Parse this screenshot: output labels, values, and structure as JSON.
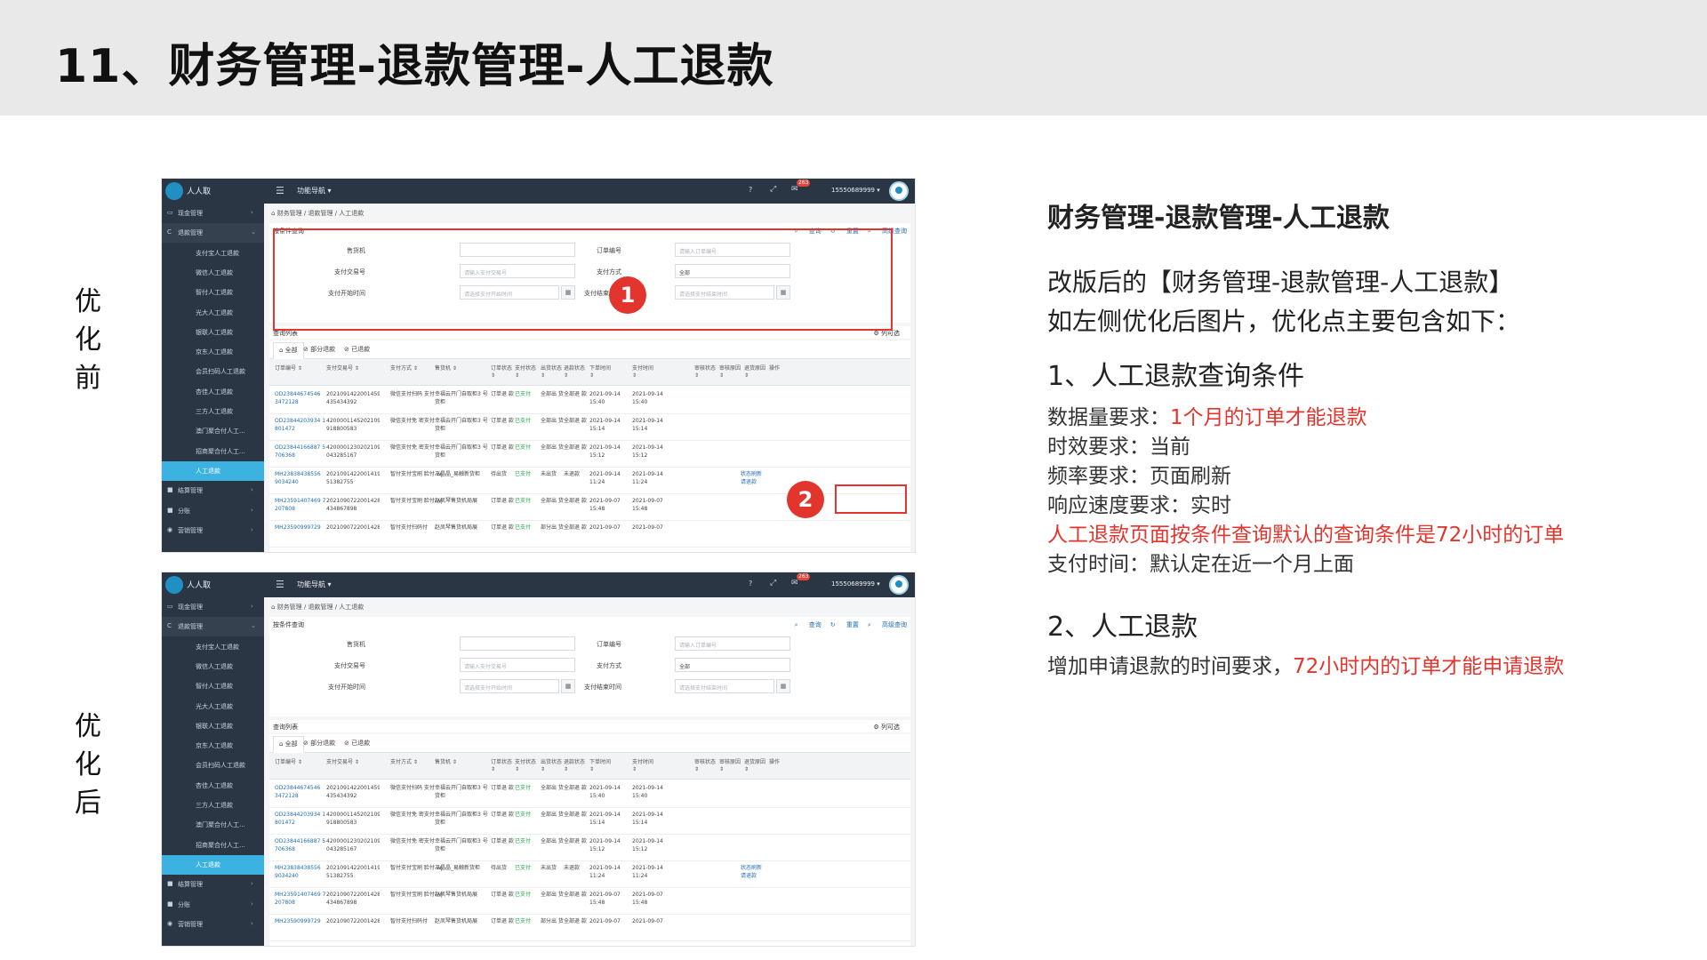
{
  "slide": {
    "title": "11、财务管理-退款管理-人工退款",
    "label_before": "优化前",
    "label_after": "优化后"
  },
  "screenshot": {
    "app_name": "人人取",
    "func_nav": "功能导航 ▾",
    "help": "?",
    "notif_count": "263",
    "user": "15550689999 ▾",
    "breadcrumb": "财务管理 / 退款管理 / 人工退款",
    "sidebar": [
      {
        "label": "现金管理",
        "level": 1,
        "icon": "▭",
        "arrow": "›"
      },
      {
        "label": "退款管理",
        "level": 1,
        "icon": "C",
        "arrow": "⌄",
        "open": true
      },
      {
        "label": "支付宝人工退款",
        "level": 2
      },
      {
        "label": "微信人工退款",
        "level": 2
      },
      {
        "label": "智付人工退款",
        "level": 2
      },
      {
        "label": "光大人工退款",
        "level": 2
      },
      {
        "label": "银联人工退款",
        "level": 2
      },
      {
        "label": "京东人工退款",
        "level": 2
      },
      {
        "label": "会员扫码人工退款",
        "level": 2
      },
      {
        "label": "杏佳人工退款",
        "level": 2
      },
      {
        "label": "三方人工退款",
        "level": 2
      },
      {
        "label": "澳门聚合付人工...",
        "level": 2
      },
      {
        "label": "招商聚合付人工...",
        "level": 2
      },
      {
        "label": "人工退款",
        "level": 2,
        "active": true
      },
      {
        "label": "结算管理",
        "level": 1,
        "icon": "■",
        "arrow": "›"
      },
      {
        "label": "分账",
        "level": 1,
        "icon": "■",
        "arrow": "›"
      },
      {
        "label": "营销管理",
        "level": 1,
        "icon": "◉",
        "arrow": "›"
      }
    ],
    "search_panel": {
      "title": "按条件查询",
      "actions": [
        "查询",
        "重置",
        "高级查询"
      ],
      "fields": {
        "sale_machine": {
          "label": "售货机",
          "placeholder": ""
        },
        "order_no": {
          "label": "订单编号",
          "placeholder": "请输入订单编号"
        },
        "pay_trade_no": {
          "label": "支付交易号",
          "placeholder": "请输入支付交易号"
        },
        "pay_method": {
          "label": "支付方式",
          "value": "全部"
        },
        "pay_start": {
          "label": "支付开始时间",
          "placeholder": "请选择支付开始时间"
        },
        "pay_end": {
          "label": "支付结束时间",
          "placeholder": "请选择支付结束时间"
        }
      }
    },
    "list": {
      "title": "查询列表",
      "column_selector": "列可选",
      "tabs": [
        "全部",
        "部分退款",
        "已退款"
      ],
      "headers": [
        "订单编号 ⇕",
        "支付交易号 ⇕",
        "支付方式 ⇕",
        "售货机 ⇕",
        "订单状态 ⇕",
        "支付状态 ⇕",
        "出货状态 ⇕",
        "退款状态 ⇕",
        "下单时间 ⇕",
        "支付时间 ⇕",
        "审核状态 ⇕",
        "审核原因 ⇕",
        "退货原因 ⇕",
        "操作"
      ],
      "rows": [
        [
          "OD23844674546 3472128",
          "2021091422001459461 435434392",
          "微信支付扫码 支付",
          "幸福云开门自取柜3 号货柜",
          "订单退 款",
          "已支付",
          "全部出 货",
          "全部退 款",
          "2021-09-14 15:40",
          "2021-09-14 15:40",
          ""
        ],
        [
          "OD23844203934 1 801472",
          "4200001145202109148 918800583",
          "微信支付免 密支付",
          "幸福云开门自取柜3 号货柜",
          "订单退 款",
          "已支付",
          "全部出 货",
          "全部退 款",
          "2021-09-14 15:14",
          "2021-09-14 15:14",
          ""
        ],
        [
          "OD23844166887 5 706368",
          "4200001230202109145 043285167",
          "微信支付免 密支付",
          "幸福云开门自取柜3 号货柜",
          "订单退 款",
          "已支付",
          "全部出 货",
          "全部退 款",
          "2021-09-14 15:12",
          "2021-09-14 15:12",
          ""
        ],
        [
          "MH23838438556 9034240",
          "2021091422001419814 51382755",
          "智付支付宝刷 脸付-wj",
          "王晶晶_易触新货柜",
          "待出货",
          "已支付",
          "未出货",
          "未退款",
          "2021-09-14 11:24",
          "2021-09-14 11:24",
          "状态刷新 请退款"
        ],
        [
          "MH23591407469 7 207808",
          "2021090722001428621 434867898",
          "智付支付宝刷 脸付-wj",
          "赵凤琴售货机局展",
          "订单退 款",
          "已支付",
          "全部出 货",
          "全部退 款",
          "2021-09-07 15:48",
          "2021-09-07 15:48",
          ""
        ],
        [
          "MH23590999729",
          "2021090722001428621",
          "智付支付扫码付",
          "赵凤琴售货机局展",
          "订单退 款",
          "已支付",
          "部分出 货",
          "全部退 款",
          "2021-09-07",
          "2021-09-07",
          ""
        ]
      ]
    }
  },
  "markers": [
    "1",
    "2"
  ],
  "notes": {
    "heading": "财务管理-退款管理-人工退款",
    "intro_1": "改版后的【财务管理-退款管理-人工退款】",
    "intro_2": "如左侧优化后图片，优化点主要包含如下：",
    "sec1_title": "1、人工退款查询条件",
    "data_req_label": "数据量要求：",
    "data_req_value": "1个月的订单才能退款",
    "time_req": "时效要求：当前",
    "freq_req": "频率要求：页面刷新",
    "speed_req": "响应速度要求：实时",
    "default_query": "人工退款页面按条件查询默认的查询条件是72小时的订单",
    "pay_time": "支付时间：默认定在近一个月上面",
    "sec2_title": "2、人工退款",
    "sec2_label": "增加申请退款的时间要求，",
    "sec2_value": "72小时内的订单才能申请退款"
  },
  "colors": {
    "accent_red": "#e2352d",
    "header_dark": "#2b3645",
    "active_blue": "#3bb2e0",
    "link_blue": "#1f6fb4",
    "ok_green": "#22a745"
  }
}
